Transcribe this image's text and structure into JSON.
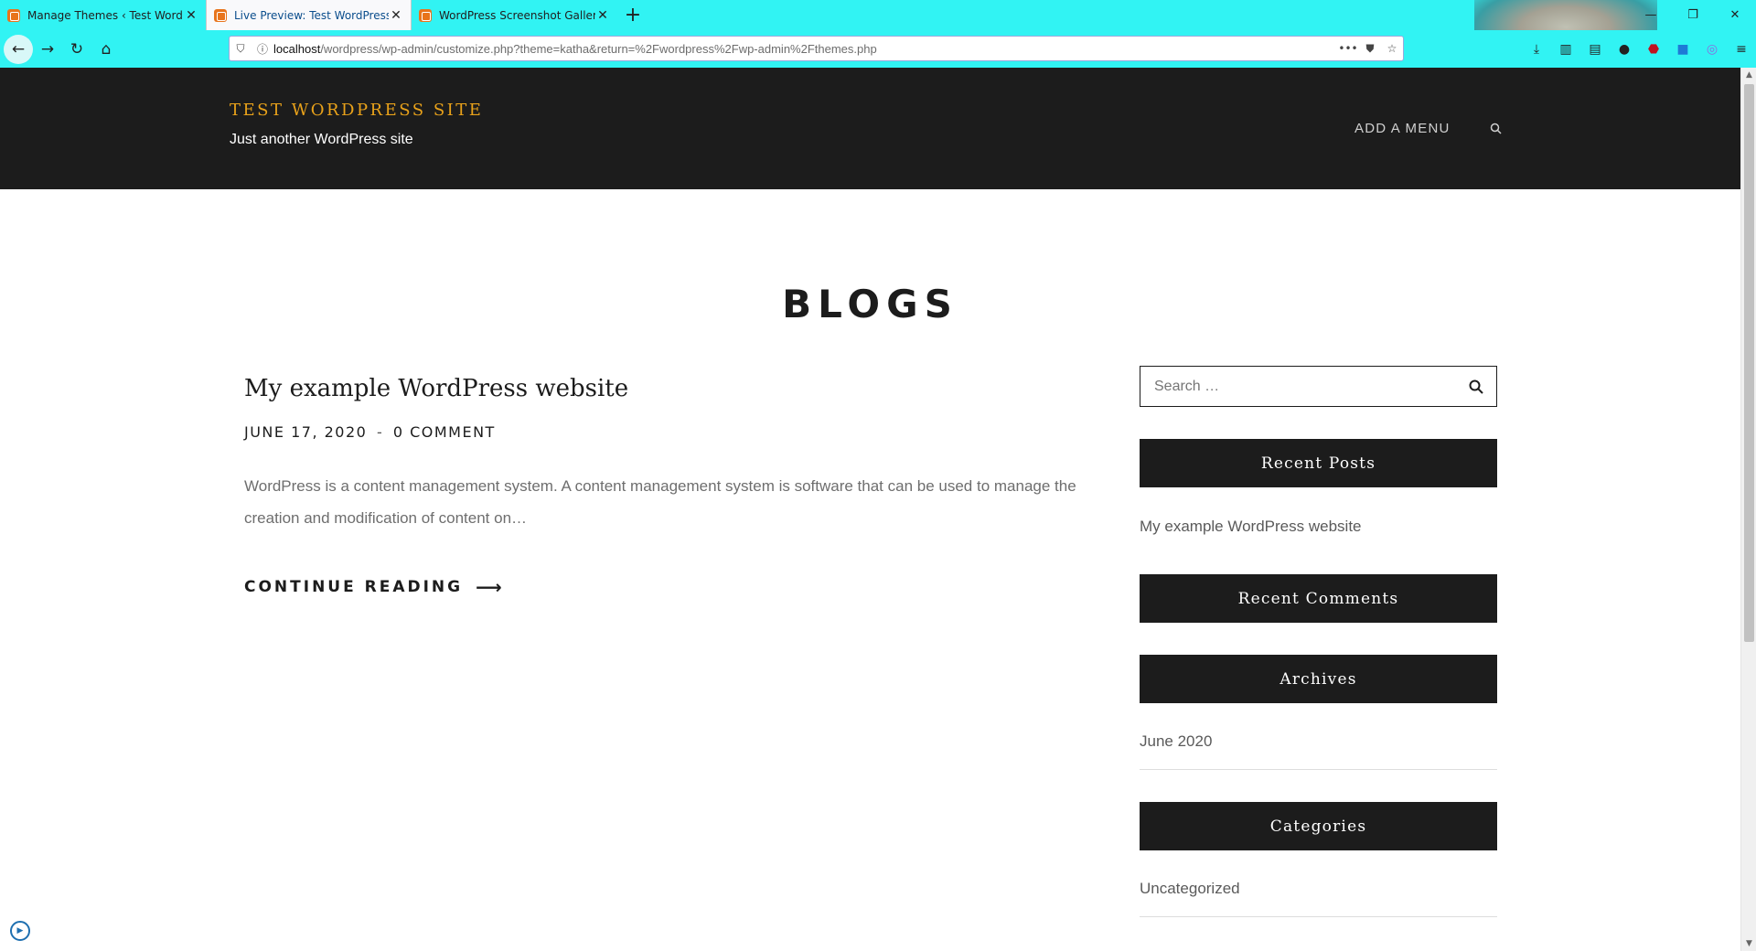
{
  "browser": {
    "tabs": [
      {
        "label": "Manage Themes ‹ Test WordPress",
        "active": false
      },
      {
        "label": "Live Preview: Test WordPress Site",
        "active": true
      },
      {
        "label": "WordPress Screenshot Gallery",
        "active": false
      }
    ],
    "new_tab_symbol": "+",
    "url_host": "localhost",
    "url_path": "/wordpress/wp-admin/customize.php?theme=katha&return=%2Fwordpress%2Fwp-admin%2Fthemes.php",
    "icons": [
      "back-icon",
      "forward-icon",
      "reload-icon",
      "home-icon",
      "shield-icon",
      "info-icon",
      "more-icon",
      "pocket-icon",
      "bookmark-star-icon",
      "downloads-icon",
      "library-icon",
      "reader-icon",
      "account-icon",
      "ublock-icon",
      "extension-s-icon",
      "extension-location-icon",
      "menu-icon"
    ]
  },
  "site": {
    "title": "TEST WORDPRESS SITE",
    "tagline": "Just another WordPress site",
    "menu_label": "ADD A MENU",
    "title_color": "#e9a21a",
    "header_bg": "#1c1c1c"
  },
  "main": {
    "page_title": "BLOGS",
    "post": {
      "title": "My example WordPress website",
      "date": "JUNE 17, 2020",
      "separator": "-",
      "comments": "0 COMMENT",
      "excerpt": "WordPress is a content management system. A content management system is software that can be used to manage the creation and modification of content on…",
      "continue_label": "CONTINUE READING",
      "continue_arrow": "⟶"
    }
  },
  "sidebar": {
    "search_placeholder": "Search …",
    "recent_posts": {
      "heading": "Recent Posts",
      "items": [
        "My example WordPress website"
      ]
    },
    "recent_comments": {
      "heading": "Recent Comments"
    },
    "archives": {
      "heading": "Archives",
      "items": [
        "June 2020"
      ]
    },
    "categories": {
      "heading": "Categories",
      "items": [
        "Uncategorized"
      ]
    }
  }
}
